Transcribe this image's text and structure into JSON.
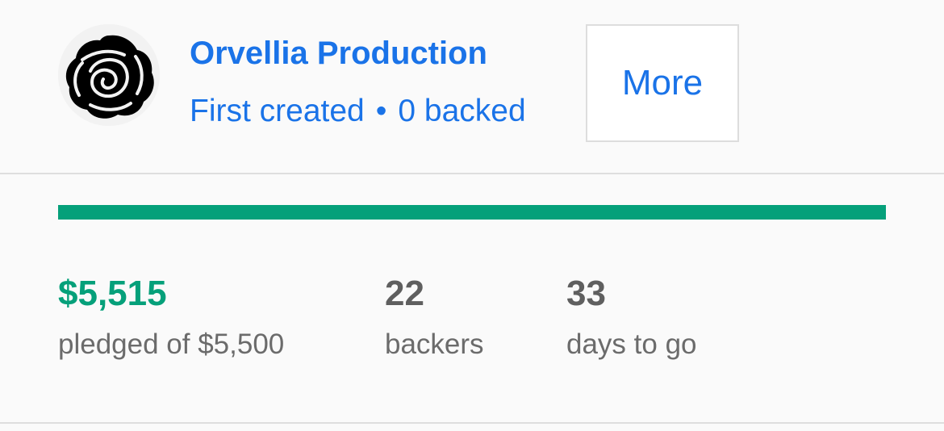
{
  "creator": {
    "name": "Orvellia Production",
    "status": "First created",
    "separator": "•",
    "backed": "0 backed",
    "avatar_icon": "rose-icon",
    "more_label": "More"
  },
  "progress": {
    "percent_funded": 100,
    "color": "#05a07a"
  },
  "stats": {
    "pledged_value": "$5,515",
    "pledged_label": "pledged of $5,500",
    "backers_value": "22",
    "backers_label": "backers",
    "days_value": "33",
    "days_label": "days to go"
  },
  "colors": {
    "link": "#1a73e8",
    "accent": "#05a07a",
    "background": "#fafafa"
  }
}
